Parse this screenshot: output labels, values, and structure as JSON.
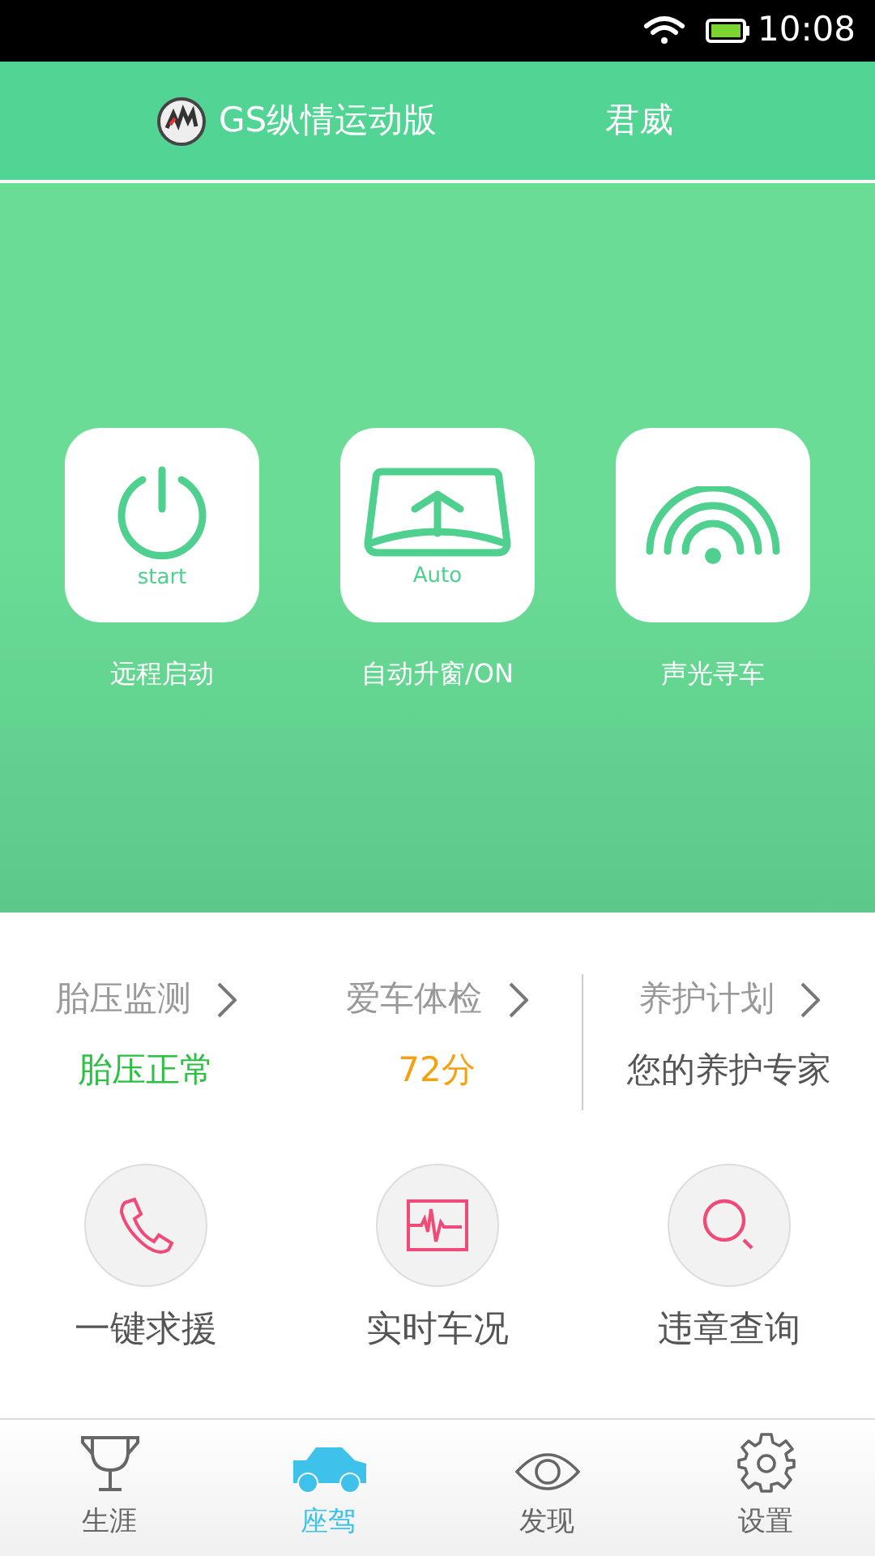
{
  "status_bar": {
    "time": "10:08"
  },
  "header": {
    "model": "GS纵情运动版",
    "brand": "君威"
  },
  "quick_actions": [
    {
      "kind": "power",
      "icon_label": "start",
      "label": "远程启动"
    },
    {
      "kind": "window",
      "icon_label": "Auto",
      "label": "自动升窗/ON"
    },
    {
      "kind": "signal",
      "label": "声光寻车"
    }
  ],
  "info": [
    {
      "title": "胎压监测",
      "value": "胎压正常",
      "color": "#2cc044"
    },
    {
      "title": "爱车体检",
      "value": "72分",
      "color": "#f5a00e"
    },
    {
      "title": "养护计划",
      "value": "您的养护专家",
      "color": "#555555"
    }
  ],
  "services": [
    {
      "kind": "phone",
      "label": "一键求援"
    },
    {
      "kind": "monitor",
      "label": "实时车况"
    },
    {
      "kind": "search",
      "label": "违章查询"
    }
  ],
  "tabs": [
    {
      "kind": "trophy",
      "label": "生涯",
      "selected": false
    },
    {
      "kind": "car",
      "label": "座驾",
      "selected": true
    },
    {
      "kind": "eye",
      "label": "发现",
      "selected": false
    },
    {
      "kind": "gear",
      "label": "设置",
      "selected": false
    }
  ]
}
